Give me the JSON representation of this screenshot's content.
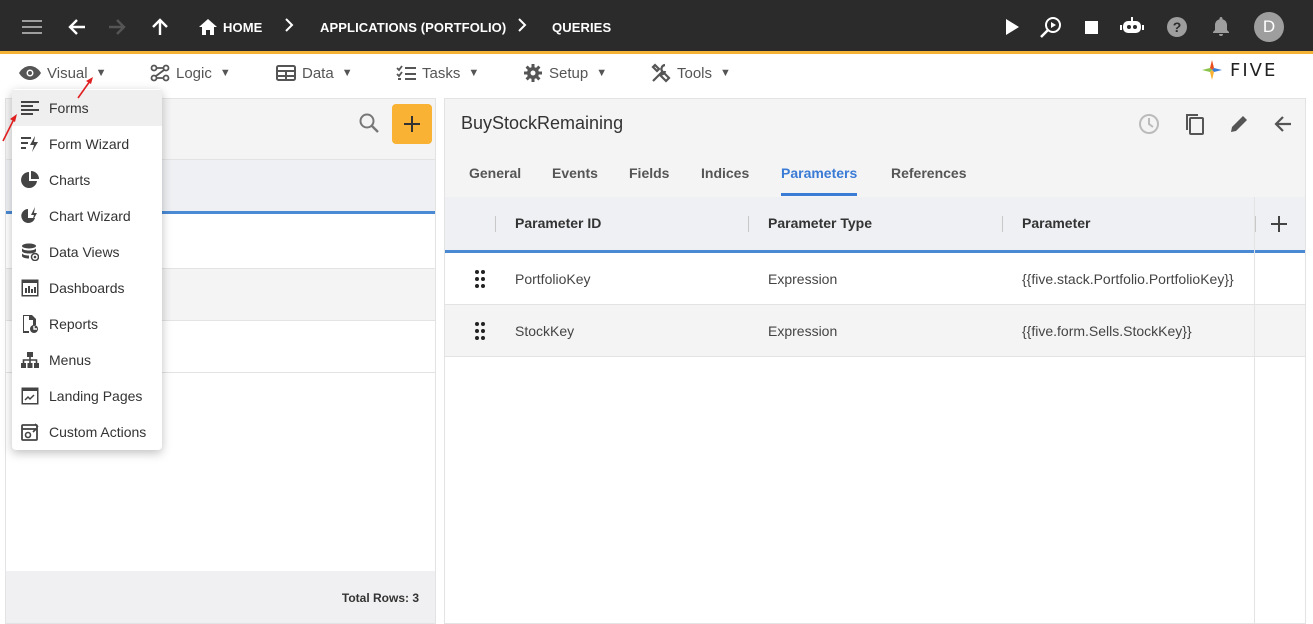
{
  "topbar": {
    "breadcrumbs": [
      "HOME",
      "APPLICATIONS (PORTFOLIO)",
      "QUERIES"
    ],
    "avatar_initial": "D"
  },
  "menubar": {
    "items": [
      {
        "label": "Visual",
        "icon": "eye-icon"
      },
      {
        "label": "Logic",
        "icon": "logic-icon"
      },
      {
        "label": "Data",
        "icon": "table-icon"
      },
      {
        "label": "Tasks",
        "icon": "checklist-icon"
      },
      {
        "label": "Setup",
        "icon": "gear-icon"
      },
      {
        "label": "Tools",
        "icon": "tools-icon"
      }
    ],
    "caret": "▼",
    "logo_text": "FIVE"
  },
  "dropdown": {
    "items": [
      "Forms",
      "Form Wizard",
      "Charts",
      "Chart Wizard",
      "Data Views",
      "Dashboards",
      "Reports",
      "Menus",
      "Landing Pages",
      "Custom Actions"
    ]
  },
  "left_panel": {
    "total_rows": "Total Rows: 3"
  },
  "right_panel": {
    "title": "BuyStockRemaining",
    "tabs": [
      "General",
      "Events",
      "Fields",
      "Indices",
      "Parameters",
      "References"
    ],
    "active_tab": "Parameters",
    "columns": [
      "Parameter ID",
      "Parameter Type",
      "Parameter"
    ],
    "rows": [
      {
        "id": "PortfolioKey",
        "type": "Expression",
        "parameter": "{{five.stack.Portfolio.PortfolioKey}}"
      },
      {
        "id": "StockKey",
        "type": "Expression",
        "parameter": "{{five.form.Sells.StockKey}}"
      }
    ]
  },
  "colors": {
    "accent_yellow": "#f9b233",
    "accent_blue": "#3a7bd5",
    "topbar_bg": "#2b2b2b"
  }
}
